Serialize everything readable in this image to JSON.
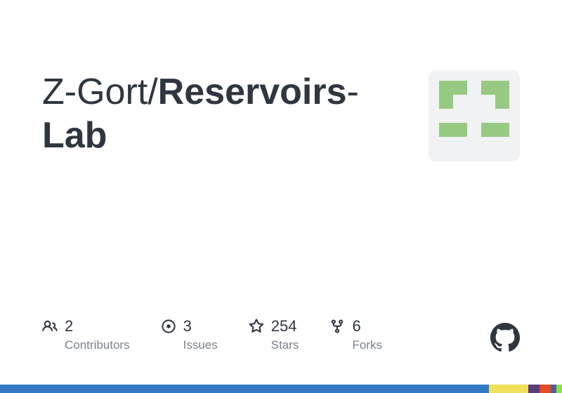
{
  "repo": {
    "owner": "Z-Gort",
    "separator": "/",
    "name_part1": "Reservoirs",
    "hyphen": "-",
    "name_part2": "Lab"
  },
  "stats": {
    "contributors": {
      "value": "2",
      "label": "Contributors"
    },
    "issues": {
      "value": "3",
      "label": "Issues"
    },
    "stars": {
      "value": "254",
      "label": "Stars"
    },
    "forks": {
      "value": "6",
      "label": "Forks"
    }
  },
  "colors": {
    "identicon": "#96c982",
    "strip": [
      {
        "color": "#3178c6",
        "width": "87%"
      },
      {
        "color": "#f1e05a",
        "width": "7%"
      },
      {
        "color": "#563d7c",
        "width": "2%"
      },
      {
        "color": "#e34c26",
        "width": "2%"
      },
      {
        "color": "#4F5D95",
        "width": "1%"
      },
      {
        "color": "#89e051",
        "width": "1%"
      }
    ]
  }
}
